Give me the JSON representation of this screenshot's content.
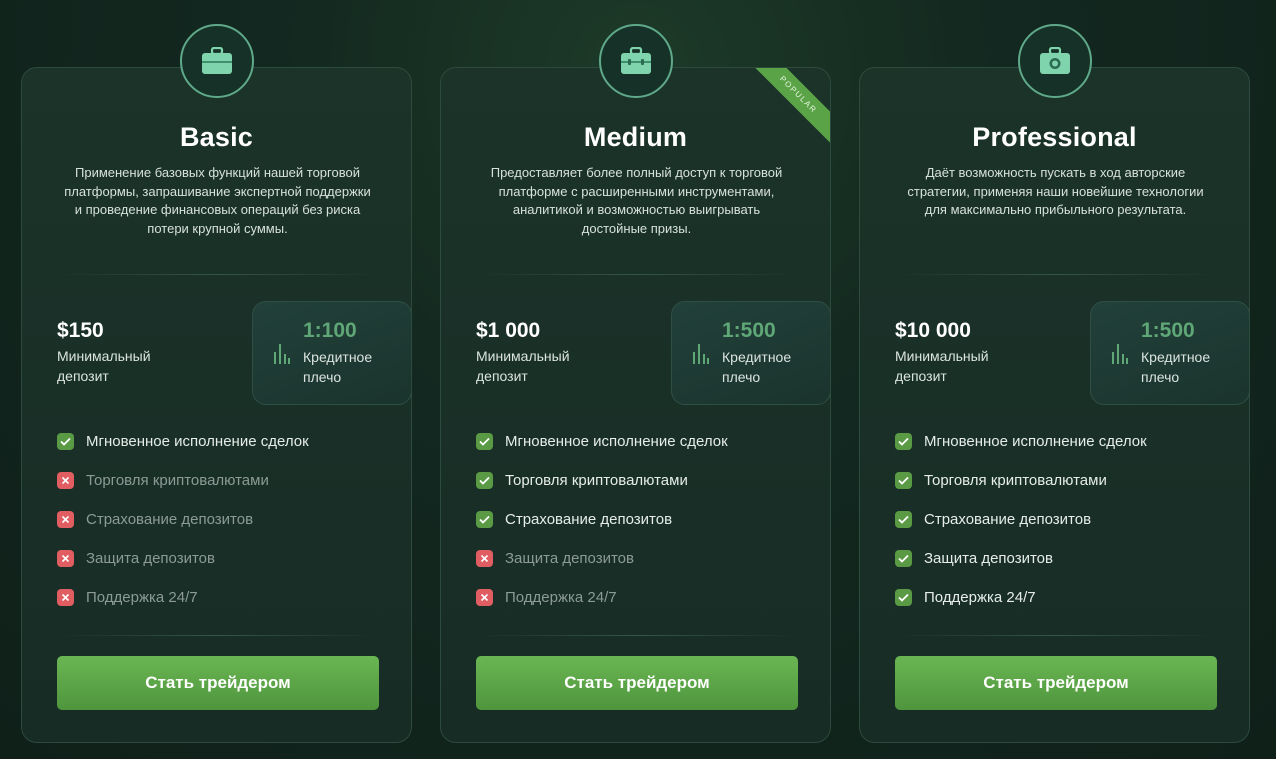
{
  "colors": {
    "accent": "#5fa777",
    "button": "#5b9f45",
    "check_on": "#5b9a45",
    "check_off": "#e05d62",
    "ribbon": "#5aa447"
  },
  "plans": [
    {
      "icon": "briefcase-icon",
      "title": "Basic",
      "description": "Применение базовых функций нашей торговой платформы, запрашивание экспертной поддержки и проведение финансовых операций без риска потери крупной суммы.",
      "deposit_amount": "$150",
      "deposit_label": "Минимальный депозит",
      "leverage_value": "1:100",
      "leverage_label": "Кредитное плечо",
      "features": [
        {
          "label": "Мгновенное исполнение сделок",
          "included": true
        },
        {
          "label": "Торговля криптовалютами",
          "included": false
        },
        {
          "label": "Страхование депозитов",
          "included": false
        },
        {
          "label": "Защита депозитов",
          "included": false
        },
        {
          "label": "Поддержка 24/7",
          "included": false
        }
      ],
      "cta": "Стать трейдером"
    },
    {
      "icon": "briefcase-icon",
      "title": "Medium",
      "ribbon": "POPULAR",
      "description": "Предоставляет более полный доступ к торговой платформе с расширенными инструментами, аналитикой и возможностью выигрывать достойные призы.",
      "deposit_amount": "$1 000",
      "deposit_label": "Минимальный депозит",
      "leverage_value": "1:500",
      "leverage_label": "Кредитное плечо",
      "features": [
        {
          "label": "Мгновенное исполнение сделок",
          "included": true
        },
        {
          "label": "Торговля криптовалютами",
          "included": true
        },
        {
          "label": "Страхование депозитов",
          "included": true
        },
        {
          "label": "Защита депозитов",
          "included": false
        },
        {
          "label": "Поддержка 24/7",
          "included": false
        }
      ],
      "cta": "Стать трейдером"
    },
    {
      "icon": "money-icon",
      "title": "Professional",
      "description": "Даёт возможность пускать в ход авторские стратегии, применяя наши новейшие технологии для максимально прибыльного результата.",
      "deposit_amount": "$10 000",
      "deposit_label": "Минимальный депозит",
      "leverage_value": "1:500",
      "leverage_label": "Кредитное плечо",
      "features": [
        {
          "label": "Мгновенное исполнение сделок",
          "included": true
        },
        {
          "label": "Торговля криптовалютами",
          "included": true
        },
        {
          "label": "Страхование депозитов",
          "included": true
        },
        {
          "label": "Защита депозитов",
          "included": true
        },
        {
          "label": "Поддержка 24/7",
          "included": true
        }
      ],
      "cta": "Стать трейдером"
    }
  ]
}
